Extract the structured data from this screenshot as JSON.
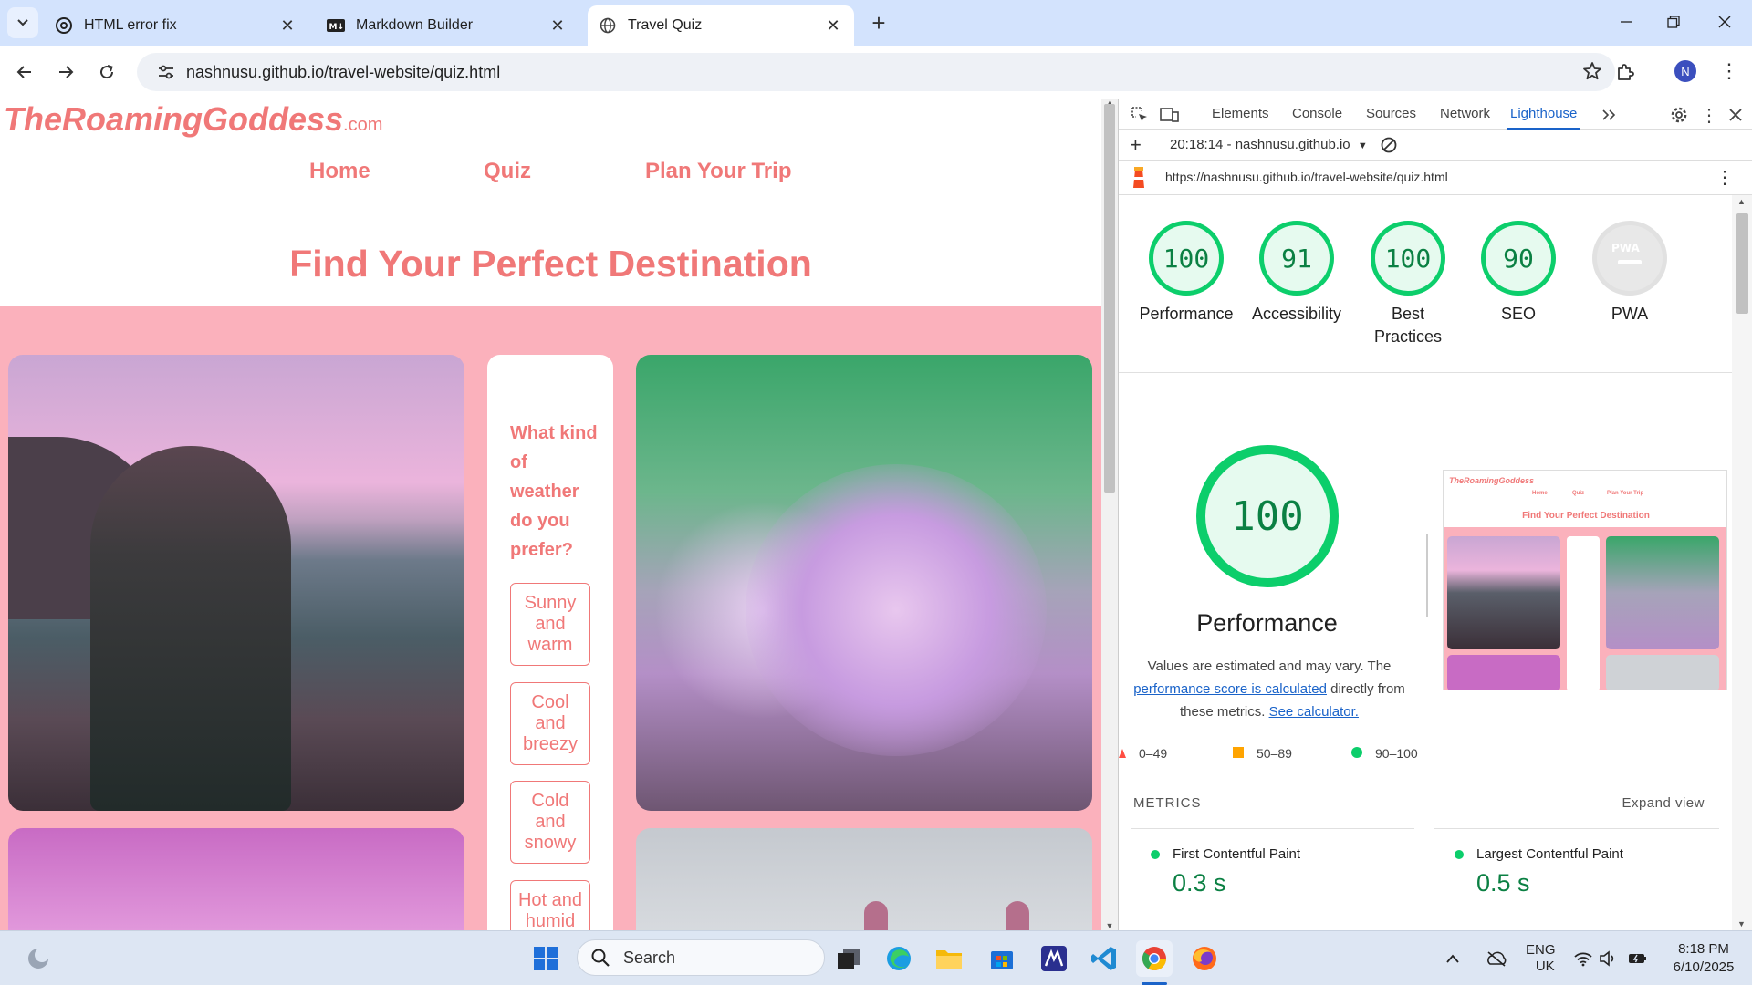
{
  "browser": {
    "tabs": [
      {
        "title": "HTML error fix",
        "active": false,
        "icon": "openai-icon"
      },
      {
        "title": "Markdown Builder",
        "active": false,
        "icon": "markdown-icon"
      },
      {
        "title": "Travel Quiz",
        "active": true,
        "icon": "globe-icon"
      }
    ],
    "url": "nashnusu.github.io/travel-website/quiz.html",
    "profile_initial": "N"
  },
  "site": {
    "logo_main": "TheRoamingGoddess",
    "logo_suffix": ".com",
    "nav": [
      "Home",
      "Quiz",
      "Plan Your Trip"
    ],
    "title": "Find Your Perfect Destination",
    "quiz_question": "What kind of weather do you prefer?",
    "options": [
      "Sunny and warm",
      "Cool and breezy",
      "Cold and snowy",
      "Hot and humid"
    ],
    "colors": {
      "accent": "#f07878",
      "background": "#fbb1bc"
    }
  },
  "devtools": {
    "tabs": [
      "Elements",
      "Console",
      "Sources",
      "Network",
      "Lighthouse"
    ],
    "active_tab": "Lighthouse",
    "report_time": "20:18:14 - nashnusu.github.io",
    "report_url": "https://nashnusu.github.io/travel-website/quiz.html",
    "scores": [
      {
        "label": "Performance",
        "value": "100"
      },
      {
        "label": "Accessibility",
        "value": "91"
      },
      {
        "label": "Best Practices",
        "value": "100"
      },
      {
        "label": "SEO",
        "value": "90"
      },
      {
        "label": "PWA",
        "value": "PWA"
      }
    ],
    "performance": {
      "score": "100",
      "title": "Performance",
      "desc_prefix": "Values are estimated and may vary. The",
      "desc_link": "performance score is calculated",
      "desc_mid": "directly from these metrics.",
      "desc_link2": "See calculator."
    },
    "legend": [
      "0–49",
      "50–89",
      "90–100"
    ],
    "metrics_heading": "METRICS",
    "expand_label": "Expand view",
    "metrics": [
      {
        "name": "First Contentful Paint",
        "value": "0.3 s"
      },
      {
        "name": "Largest Contentful Paint",
        "value": "0.5 s"
      }
    ],
    "colors": {
      "pass": "#0cce6b",
      "average": "#ffa400",
      "fail": "#ff4e42"
    }
  },
  "taskbar": {
    "search_placeholder": "Search",
    "language": "ENG",
    "region": "UK",
    "time": "8:18 PM",
    "date": "6/10/2025"
  }
}
